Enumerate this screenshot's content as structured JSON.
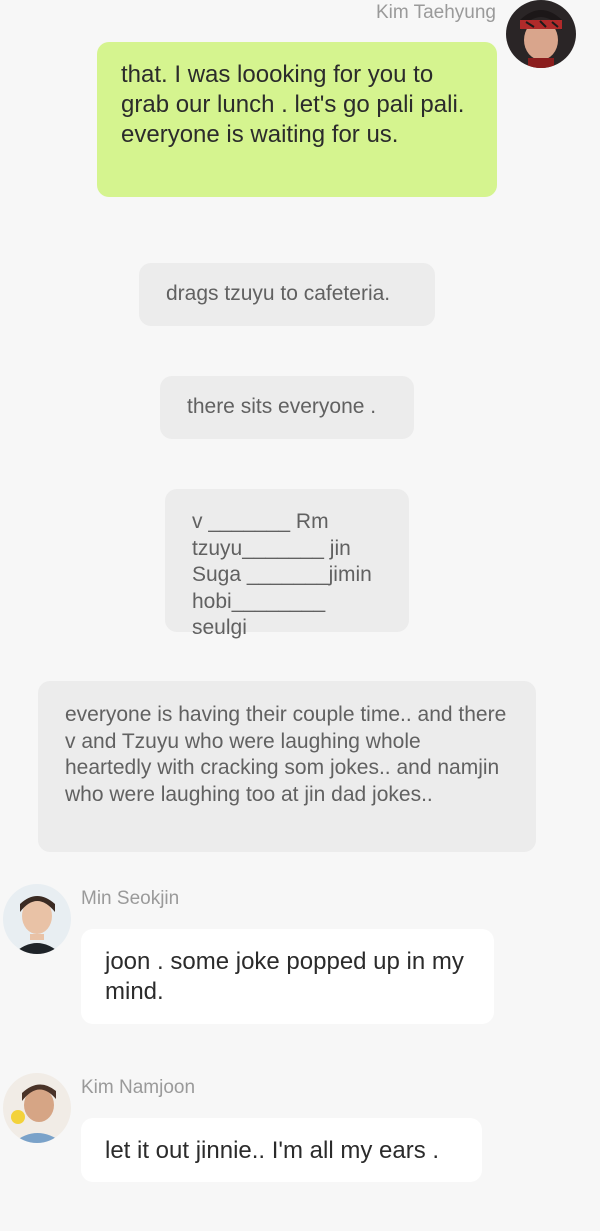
{
  "messages": [
    {
      "type": "sent",
      "sender": "Kim Taehyung",
      "avatar_icon": "avatar-taehyung-icon",
      "text": "that.  I was loooking for you to grab our lunch . let's go pali pali.  everyone is waiting for us."
    },
    {
      "type": "narration",
      "text": "drags tzuyu to cafeteria."
    },
    {
      "type": "narration",
      "text": "there sits everyone ."
    },
    {
      "type": "narration",
      "text": "v       _______ Rm\ntzuyu_______ jin\nSuga _______jimin\nhobi________ seulgi"
    },
    {
      "type": "narration",
      "text": "everyone is having their couple time.. and there v and Tzuyu who were laughing whole heartedly with cracking som jokes.. and namjin who were laughing too at jin dad jokes.."
    },
    {
      "type": "received",
      "sender": "Min Seokjin",
      "avatar_icon": "avatar-seokjin-icon",
      "text": "joon . some joke popped up in my mind."
    },
    {
      "type": "received",
      "sender": "Kim Namjoon",
      "avatar_icon": "avatar-namjoon-icon",
      "text": "let it out jinnie.. I'm all my ears ."
    }
  ],
  "colors": {
    "background": "#f7f7f7",
    "sent_bubble": "#d5f48f",
    "received_bubble": "#ffffff",
    "narration_bubble": "#ececec",
    "sender_name": "#9a9a9a"
  }
}
